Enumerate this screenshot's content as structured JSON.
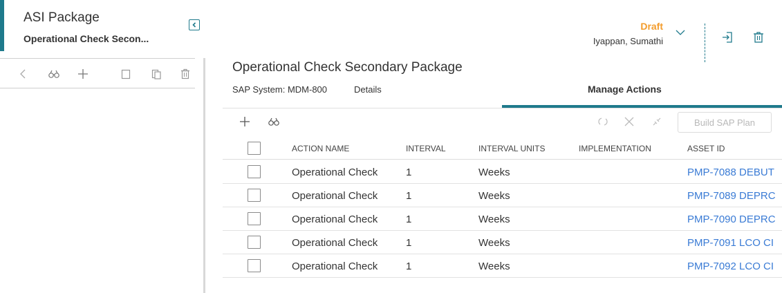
{
  "left_panel": {
    "title": "ASI Package",
    "subtitle": "Operational Check Secon..."
  },
  "header": {
    "status": "Draft",
    "user": "Iyappan, Sumathi"
  },
  "page": {
    "title": "Operational Check Secondary Package",
    "sap_system": "SAP System: MDM-800",
    "tabs": [
      {
        "label": "Details"
      },
      {
        "label": "Manage Actions"
      }
    ]
  },
  "grid": {
    "build_button_label": "Build SAP Plan",
    "columns": [
      "ACTION NAME",
      "INTERVAL",
      "INTERVAL UNITS",
      "IMPLEMENTATION",
      "ASSET ID"
    ],
    "rows": [
      {
        "action_name": "Operational Check",
        "interval": "1",
        "interval_units": "Weeks",
        "implementation": "",
        "asset_id": "PMP-7088 DEBUT"
      },
      {
        "action_name": "Operational Check",
        "interval": "1",
        "interval_units": "Weeks",
        "implementation": "",
        "asset_id": "PMP-7089 DEPRC"
      },
      {
        "action_name": "Operational Check",
        "interval": "1",
        "interval_units": "Weeks",
        "implementation": "",
        "asset_id": "PMP-7090 DEPRC"
      },
      {
        "action_name": "Operational Check",
        "interval": "1",
        "interval_units": "Weeks",
        "implementation": "",
        "asset_id": "PMP-7091 LCO CI"
      },
      {
        "action_name": "Operational Check",
        "interval": "1",
        "interval_units": "Weeks",
        "implementation": "",
        "asset_id": "PMP-7092 LCO CI"
      }
    ]
  },
  "icons": {
    "left_toolbar": [
      "back-icon",
      "binoculars-icon",
      "plus-icon",
      "copy-icon",
      "paste-icon",
      "trash-icon"
    ],
    "grid_toolbar": [
      "plus-icon",
      "binoculars-icon",
      "refresh-icon",
      "close-icon",
      "link-icon"
    ],
    "header": [
      "chevron-down-icon",
      "export-icon",
      "trash-icon"
    ]
  },
  "colors": {
    "accent": "#1f7a8c",
    "draft": "#f39c2c",
    "link": "#3a7bd5"
  }
}
